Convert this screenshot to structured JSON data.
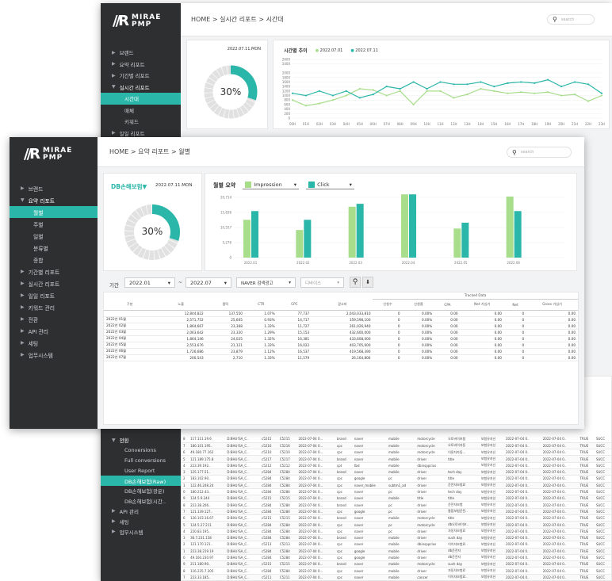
{
  "brand": {
    "name_line1": "MIRAE",
    "name_line2": "PMP"
  },
  "back_window": {
    "breadcrumb": [
      "HOME",
      "실시간 리포트",
      "시간대"
    ],
    "search_placeholder": "search",
    "sidebar": [
      {
        "label": "브랜드"
      },
      {
        "label": "요약 리포트"
      },
      {
        "label": "기간별 리포트"
      },
      {
        "label": "실시간 리포트",
        "expanded": true
      },
      {
        "label": "시간대",
        "sub": true,
        "active": true
      },
      {
        "label": "매체",
        "sub": true
      },
      {
        "label": "키워드",
        "sub": true
      },
      {
        "label": "일일 리포트"
      }
    ],
    "date": "2022.07.11.MON",
    "donut_percent": "30%",
    "donut_value": 0.3,
    "chart_title": "시간별 추이",
    "legend": [
      "2022.07.01",
      "2022.07.11"
    ],
    "chart_data": {
      "type": "line",
      "categories": [
        "00H",
        "01H",
        "02H",
        "03H",
        "04H",
        "05H",
        "06H",
        "07H",
        "08H",
        "09H",
        "10H",
        "11H",
        "12H",
        "13H",
        "14H",
        "15H",
        "16H",
        "17H",
        "18H",
        "19H",
        "20H",
        "21H",
        "22H",
        "23H"
      ],
      "series": [
        {
          "name": "2022.07.01",
          "color": "#a8dd8c",
          "values": [
            800,
            550,
            650,
            800,
            1000,
            1300,
            1250,
            1000,
            1200,
            600,
            1200,
            1200,
            900,
            1050,
            1300,
            1200,
            1100,
            1150,
            1100,
            1150,
            1000,
            1050,
            750,
            1000
          ]
        },
        {
          "name": "2022.07.11",
          "color": "#2ab6a8",
          "values": [
            1100,
            1000,
            1200,
            1000,
            1200,
            900,
            1050,
            1400,
            1300,
            1600,
            1300,
            1600,
            1500,
            1500,
            1600,
            1400,
            1550,
            1600,
            1550,
            1700,
            1400,
            1600,
            1500,
            1100
          ]
        }
      ],
      "yticks": [
        0,
        200,
        400,
        600,
        800,
        1000,
        1200,
        1400,
        1600,
        1800,
        2000,
        2400,
        2600
      ],
      "ylim": [
        0,
        2600
      ]
    },
    "lower_sidebar": [
      {
        "label": "전환",
        "expanded": true
      },
      {
        "label": "Conversions",
        "sub": true
      },
      {
        "label": "Full conversions",
        "sub": true
      },
      {
        "label": "User Report",
        "sub": true
      },
      {
        "label": "DB손해보험(Raw)",
        "sub": true,
        "active": true
      },
      {
        "label": "DB손해보험(광운)",
        "sub": true
      },
      {
        "label": "DB손해보험(시간..",
        "sub": true
      },
      {
        "label": "API 관리"
      },
      {
        "label": "세팅"
      },
      {
        "label": "업무시스템"
      }
    ],
    "raw_rows": [
      [
        "8",
        "117.111.19.6",
        "D:BHU!SA_C..",
        "c5215",
        "C5215",
        "2022-07-04 0...",
        "brand",
        "naver",
        "mobile",
        "motorcycle",
        "오토바이보험",
        "보험유지신",
        "2022-07-04 0..",
        "2022-07-04 0..",
        "TRUE",
        "SUCC"
      ],
      [
        "7",
        "180.101.195..",
        "D:BHU!SA_C..",
        "c5216",
        "C5216",
        "2022-07-04 0...",
        "cpc",
        "naver",
        "mobile",
        "motorcycle",
        "오토바이자동",
        "보험유지신",
        "2022-07-04 0..",
        "2022-07-04 0..",
        "TRUE",
        "SUCC"
      ],
      [
        "6",
        "49.180.77.162",
        "D:BHU!SA_C..",
        "c5210",
        "C5210",
        "2022-07-04 0...",
        "cpc",
        "naver",
        "mobile",
        "motorcycle",
        "이륜차자동...",
        "보험유지신",
        "2022-07-04 0..",
        "2022-07-04 0..",
        "TRUE",
        "SUCC"
      ],
      [
        "5",
        "121.189.175.8",
        "D:BHU!SA_C..",
        "c5217",
        "C5217",
        "2022-07-04 0...",
        "brand",
        "naver",
        "mobile",
        "driver",
        "title",
        "보험유지신",
        "2022-07-04 0..",
        "2022-07-04 0..",
        "TRUE",
        "SUCC"
      ],
      [
        "4",
        "223.39.192..",
        "D:BHU!SA_C..",
        "c5212",
        "C5212",
        "2022-07-04 0...",
        "cpt",
        "tbd",
        "mobile",
        "dbinsppclus",
        "",
        "보험유지신",
        "2022-07-04 0..",
        "2022-07-04 0..",
        "TRUE",
        "SUCC"
      ],
      [
        "3",
        "125.177.51..",
        "D:BHU!SA_C..",
        "c5284",
        "C5284",
        "2022-07-04 0...",
        "brand",
        "naver",
        "mobile",
        "driver",
        "tech day",
        "보험유지신",
        "2022-07-04 0..",
        "2022-07-04 0..",
        "TRUE",
        "SUCC"
      ],
      [
        "2",
        "183.102.90..",
        "D:BHU!SA_C..",
        "c5284",
        "C5284",
        "2022-07-04 0...",
        "cpc",
        "google",
        "pc",
        "driver",
        "title",
        "보험유지신",
        "2022-07-04 0..",
        "2022-07-04 0..",
        "TRUE",
        "SUCC"
      ],
      [
        "1",
        "122.46.248.24",
        "D:BHU!SA_C..",
        "c5284",
        "C5284",
        "2022-07-04 0...",
        "cpc",
        "naver_mobile",
        "subtm1_ad",
        "driver",
        "운전자보험료",
        "보험유지신",
        "2022-07-04 0..",
        "2022-07-04 0..",
        "TRUE",
        "SUCC"
      ],
      [
        "0",
        "180.212.43..",
        "D:BHU!SA_C..",
        "c5284",
        "C5284",
        "2022-07-04 0...",
        "cpc",
        "naver",
        "pc",
        "driver",
        "tech day",
        "보험유지신",
        "2022-07-04 0..",
        "2022-07-04 0..",
        "TRUE",
        "SUCC"
      ],
      [
        "9",
        "124.5.9.244",
        "D:BHU!SA_C..",
        "c5215",
        "C5215",
        "2022-07-04 0...",
        "brand",
        "naver",
        "mobile",
        "title",
        "title",
        "보험유지신",
        "2022-07-04 0..",
        "2022-07-04 0..",
        "TRUE",
        "SUCC"
      ],
      [
        "8",
        "223.38.206..",
        "D:BHU!SA_C..",
        "c5284",
        "C5284",
        "2022-07-04 0...",
        "brand",
        "naver",
        "pc",
        "driver",
        "운전자보험",
        "보험유지신",
        "2022-07-04 0..",
        "2022-07-04 0..",
        "TRUE",
        "SUCC"
      ],
      [
        "7",
        "121.139.127..",
        "D:BHU!SA_C..",
        "c5284",
        "C5284",
        "2022-07-04 0...",
        "cpc",
        "google",
        "pc",
        "driver",
        "통합보험운전..",
        "보험유지신",
        "2022-07-04 0..",
        "2022-07-04 0..",
        "TRUE",
        "SUCC"
      ],
      [
        "6",
        "126.103.16.67",
        "D:BHU!SA_C..",
        "c5215",
        "C5215",
        "2022-07-04 0...",
        "brand",
        "naver",
        "mobile",
        "motorcycle",
        "title",
        "보험유지신",
        "2022-07-04 0..",
        "2022-07-04 0..",
        "TRUE",
        "SUCC"
      ],
      [
        "5",
        "124.5.27.211",
        "D:BHU!SA_C..",
        "c5284",
        "C5284",
        "2022-07-04 0...",
        "cpc",
        "naver",
        "pc",
        "motorcycle",
        "db오토바이보..",
        "보험유지신",
        "2022-07-04 0..",
        "2022-07-04 0..",
        "TRUE",
        "SUCC"
      ],
      [
        "4",
        "220.83.195..",
        "D:BHU!SA_C..",
        "c5284",
        "C5284",
        "2022-07-04 0...",
        "cpc",
        "naver",
        "pc",
        "driver",
        "자동차보험료",
        "보험유지신",
        "2022-07-04 0..",
        "2022-07-04 0..",
        "TRUE",
        "SUCC"
      ],
      [
        "3",
        "36.7.231.158",
        "D:BHU!SA_C..",
        "c5284",
        "C5284",
        "2022-07-04 0...",
        "brand",
        "naver",
        "mobile",
        "driver",
        "such day",
        "보험유지신",
        "2022-07-04 0..",
        "2022-07-04 0..",
        "TRUE",
        "SUCC"
      ],
      [
        "2",
        "121.170.121..",
        "D:BHU!SA_C..",
        "c5213",
        "C5213",
        "2022-07-04 0...",
        "cpc",
        "naver",
        "mobile",
        "dbinsppclus",
        "이이자보험료..",
        "보험유지신",
        "2022-07-04 0..",
        "2022-07-04 0..",
        "TRUE",
        "SUCC"
      ],
      [
        "1",
        "223.38.219.19",
        "D:BHU!SA_C..",
        "c5284",
        "C5284",
        "2022-07-04 0...",
        "cpc",
        "google",
        "mobile",
        "driver",
        "db운전자",
        "보험유지신",
        "2022-07-04 0..",
        "2022-07-04 0..",
        "TRUE",
        "SUCC"
      ],
      [
        "0",
        "49.160.230.97",
        "D:BHU!SA_C..",
        "c5284",
        "C5284",
        "2022-07-04 0...",
        "cpc",
        "google",
        "mobile",
        "driver",
        "db운전자",
        "보험유지신",
        "2022-07-04 0..",
        "2022-07-04 0..",
        "TRUE",
        "SUCC"
      ],
      [
        "9",
        "211.180.90..",
        "D:BHU!SA_C..",
        "c5215",
        "C5215",
        "2022-07-04 0...",
        "brand",
        "naver",
        "mobile",
        "motorcycle",
        "such day",
        "보험유지신",
        "2022-07-04 0..",
        "2022-07-04 0..",
        "TRUE",
        "SUCC"
      ],
      [
        "8",
        "116.235.7.205",
        "D:BHU!SA_C..",
        "c5284",
        "C5284",
        "2022-07-04 0...",
        "cpc",
        "naver",
        "mobile",
        "driver",
        "자동차보험료",
        "보험유지신",
        "2022-07-04 0..",
        "2022-07-04 0..",
        "TRUE",
        "SUCC"
      ],
      [
        "7",
        "223.33.185..",
        "D:BHU!SA_C..",
        "c5211",
        "C5211",
        "2022-07-04 0...",
        "cpc",
        "naver",
        "mobile",
        "cancer",
        "이이자보험료..",
        "보험유지신",
        "2022-07-04 0..",
        "2022-07-04 0..",
        "TRUE",
        "SUCC"
      ]
    ]
  },
  "front_window": {
    "breadcrumb": [
      "HOME",
      "요약 리포트",
      "월별"
    ],
    "search_placeholder": "search",
    "sidebar": [
      {
        "label": "브랜드"
      },
      {
        "label": "요약 리포트",
        "expanded": true
      },
      {
        "label": "월별",
        "sub": true,
        "active": true
      },
      {
        "label": "주별",
        "sub": true
      },
      {
        "label": "일별",
        "sub": true
      },
      {
        "label": "분류별",
        "sub": true
      },
      {
        "label": "종합",
        "sub": true
      },
      {
        "label": "기간별 리포트"
      },
      {
        "label": "실시간 리포트"
      },
      {
        "label": "일일 리포트"
      },
      {
        "label": "키워드 관리"
      },
      {
        "label": "전환"
      },
      {
        "label": "API 관리"
      },
      {
        "label": "세팅"
      },
      {
        "label": "업무시스템"
      }
    ],
    "advertiser": "DB손해보험▼",
    "date": "2022.07.11.MON",
    "donut_percent": "30%",
    "donut_value": 0.3,
    "chart_title": "월별 요약",
    "metric1": "Impression",
    "metric2": "Click",
    "colors": {
      "impression": "#a8dd8c",
      "click": "#2ab6a8"
    },
    "chart_data": {
      "type": "bar",
      "categories": [
        "2022.01",
        "2022.02",
        "2022.03",
        "2022.04",
        "2022.05",
        "2022.06"
      ],
      "series": [
        {
          "name": "Impression",
          "values": [
            13000,
            9500,
            17500,
            23500,
            10000,
            21000
          ]
        },
        {
          "name": "Click",
          "values": [
            16000,
            13000,
            18500,
            28500,
            12000,
            16000
          ]
        }
      ],
      "yticks": [
        "0",
        "5,276",
        "10,557",
        "15,836",
        "20,714"
      ],
      "ylim": [
        0,
        20714
      ]
    },
    "filters": {
      "period_label": "기간",
      "from": "2022.01",
      "to": "2022.07",
      "media": "NAVER 검색광고",
      "device": "디바이스"
    },
    "table": {
      "headers": [
        "구분",
        "노출",
        "클릭",
        "CTR",
        "CPC",
        "광고비",
        "신청수",
        "신청율",
        "CPA",
        "Net 가입기",
        "Net",
        "Gross 가입기"
      ],
      "group_header": "Tracked Data",
      "total": [
        "",
        "12,844,822",
        "137,550",
        "1.07%",
        "77,737",
        "2,043,033,810",
        "0",
        "0.00%",
        "0.00",
        "0.00",
        "0",
        "0.00"
      ],
      "rows": [
        [
          "2022년 01월",
          "2,571,752",
          "25,605",
          "0.93%",
          "14,717",
          "359,598,100",
          "0",
          "0.00%",
          "0.00",
          "0.00",
          "0",
          "0.00"
        ],
        [
          "2022년 02월",
          "1,864,667",
          "23,368",
          "1.33%",
          "11,727",
          "261,026,940",
          "0",
          "0.00%",
          "0.00",
          "0.00",
          "0",
          "0.00"
        ],
        [
          "2022년 03월",
          "2,063,642",
          "23,320",
          "1.29%",
          "15,153",
          "432,600,000",
          "0",
          "0.00%",
          "0.00",
          "0.00",
          "0",
          "0.00"
        ],
        [
          "2022년 04월",
          "1,864,146",
          "24,025",
          "1.32%",
          "16,381",
          "433,608,000",
          "0",
          "0.00%",
          "0.00",
          "0.00",
          "0",
          "0.00"
        ],
        [
          "2022년 05월",
          "2,553,676",
          "21,121",
          "1.33%",
          "16,022",
          "403,705,600",
          "0",
          "0.00%",
          "0.00",
          "0.00",
          "0",
          "0.00"
        ],
        [
          "2022년 06월",
          "1,726,686",
          "23,879",
          "1.12%",
          "16,537",
          "419,568,390",
          "0",
          "0.00%",
          "0.00",
          "0.00",
          "0",
          "0.00"
        ],
        [
          "2022년 07월",
          "200,543",
          "2,710",
          "1.33%",
          "11,579",
          "26,164,800",
          "0",
          "0.00%",
          "0.00",
          "0.00",
          "0",
          "0.00"
        ]
      ]
    }
  }
}
